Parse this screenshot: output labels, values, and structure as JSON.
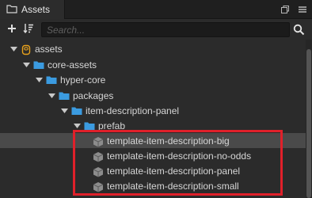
{
  "window": {
    "tab_label": "Assets"
  },
  "toolbar": {
    "search_placeholder": "Search..."
  },
  "tree": [
    {
      "label": "assets",
      "type": "db",
      "expanded": true
    },
    {
      "label": "core-assets",
      "type": "folder",
      "expanded": true
    },
    {
      "label": "hyper-core",
      "type": "folder",
      "expanded": true
    },
    {
      "label": "packages",
      "type": "folder",
      "expanded": true
    },
    {
      "label": "item-description-panel",
      "type": "folder",
      "expanded": true
    },
    {
      "label": "prefab",
      "type": "folder",
      "expanded": true
    },
    {
      "label": "template-item-description-big",
      "type": "prefab",
      "selected": true
    },
    {
      "label": "template-item-description-no-odds",
      "type": "prefab"
    },
    {
      "label": "template-item-description-panel",
      "type": "prefab"
    },
    {
      "label": "template-item-description-small",
      "type": "prefab"
    }
  ],
  "colors": {
    "folder": "#3b9be0",
    "database": "#e8a21c",
    "prefab": "#9a9a9a",
    "highlight": "#e0202a",
    "selected_row": "#4a4a4a"
  }
}
